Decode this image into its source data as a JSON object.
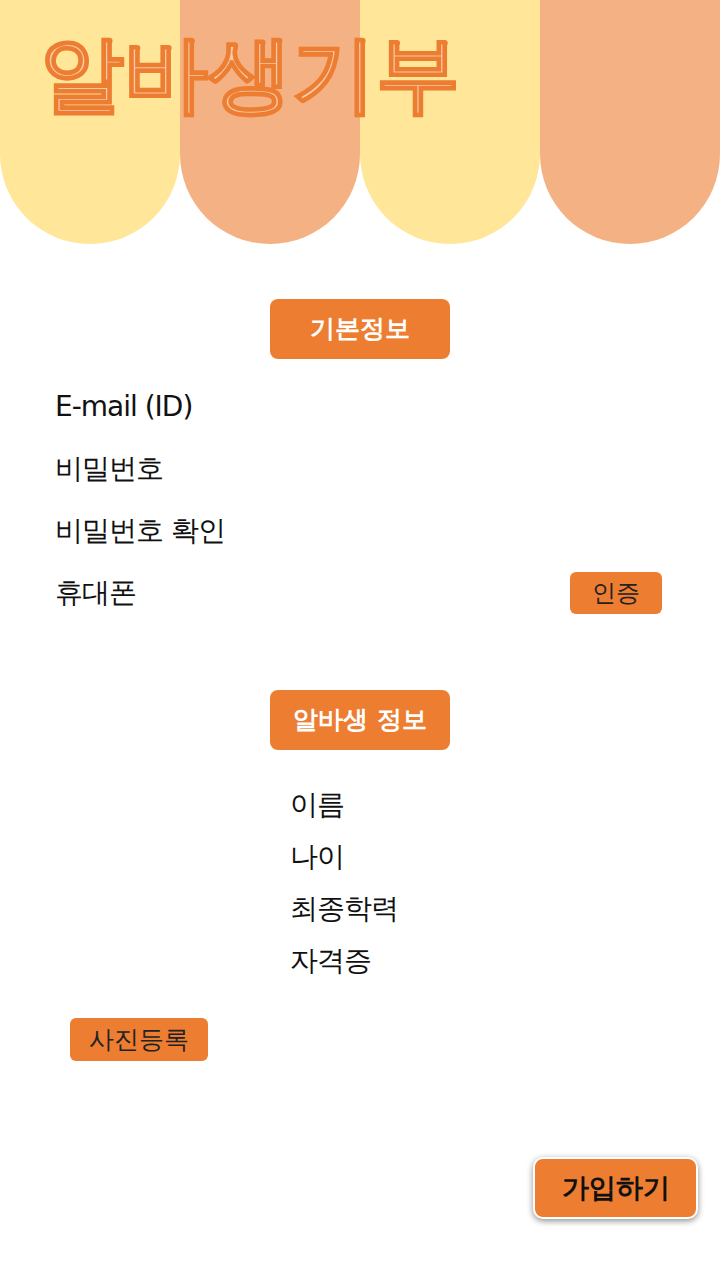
{
  "title": "알바생기부",
  "basic_info": {
    "heading": "기본정보",
    "fields": [
      "E-mail (ID)",
      "비밀번호",
      "비밀번호 확인",
      "휴대폰"
    ],
    "verify_button": "인증"
  },
  "worker_info": {
    "heading": "알바생 정보",
    "fields": [
      "이름",
      "나이",
      "최종학력",
      "자격증"
    ]
  },
  "photo_button": "사진등록",
  "submit_button": "가입하기"
}
